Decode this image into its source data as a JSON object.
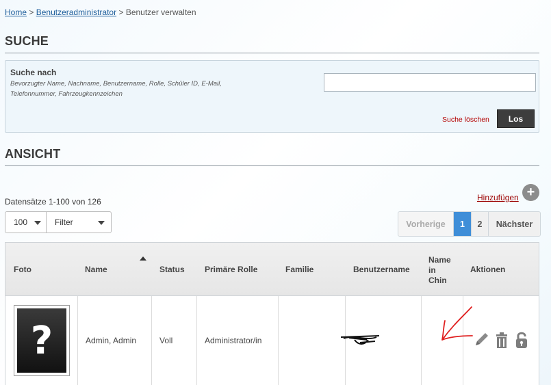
{
  "breadcrumb": {
    "home": "Home",
    "sep1": ">",
    "admin": "Benutzeradministrator",
    "sep2": ">",
    "current": "Benutzer verwalten"
  },
  "search": {
    "title": "SUCHE",
    "label": "Suche nach",
    "hint": "Bevorzugter Name, Nachname, Benutzername, Rolle, Schüler ID, E-Mail, Telefonnummer, Fahrzeugkennzeichen",
    "value": "",
    "clear_label": "Suche löschen",
    "go_label": "Los"
  },
  "view": {
    "title": "ANSICHT",
    "records_label": "Datensätze 1-100 von 126",
    "add_label": "Hinzufügen",
    "page_size": "100",
    "filter_label": "Filter"
  },
  "pagination": {
    "prev": "Vorherige",
    "pages": [
      "1",
      "2"
    ],
    "current": "1",
    "next": "Nächster"
  },
  "table": {
    "headers": {
      "photo": "Foto",
      "name": "Name",
      "status": "Status",
      "role": "Primäre Rolle",
      "family": "Familie",
      "username": "Benutzername",
      "name_chinese": "Name in Chin",
      "actions": "Aktionen"
    },
    "rows": [
      {
        "photo_glyph": "?",
        "name": "Admin, Admin",
        "status": "Voll",
        "role": "Administrator/in",
        "family": "",
        "username": "",
        "name_chinese": ""
      }
    ]
  },
  "icons": {
    "add": "plus-circle-icon",
    "edit": "pencil-icon",
    "delete": "trash-icon",
    "lock": "unlock-icon",
    "sort": "sort-ascending-icon"
  },
  "colors": {
    "accent": "#3f8ed8",
    "danger_link": "#b30000",
    "button_dark": "#3d3d3d",
    "annotation": "#e02020"
  }
}
